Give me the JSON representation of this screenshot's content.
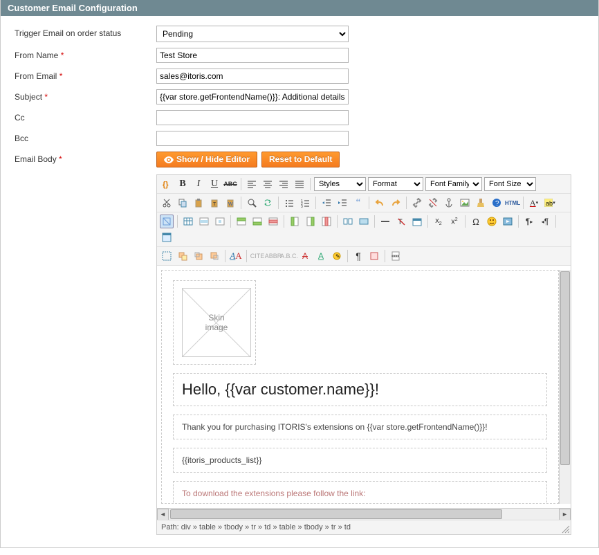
{
  "header": {
    "title": "Customer Email Configuration"
  },
  "form": {
    "trigger_label": "Trigger Email on order status",
    "trigger_value": "Pending",
    "from_name_label": "From Name",
    "from_name_value": "Test Store",
    "from_email_label": "From Email",
    "from_email_value": "sales@itoris.com",
    "subject_label": "Subject",
    "subject_value": "{{var store.getFrontendName()}}: Additional details",
    "cc_label": "Cc",
    "cc_value": "",
    "bcc_label": "Bcc",
    "bcc_value": "",
    "body_label": "Email Body"
  },
  "buttons": {
    "show_hide": "Show / Hide Editor",
    "reset": "Reset to Default"
  },
  "editor": {
    "dropdowns": {
      "styles": "Styles",
      "format": "Format",
      "fontfamily": "Font Family",
      "fontsize": "Font Size"
    },
    "content": {
      "skin_placeholder": "Skin\nimage",
      "hello": "Hello, {{var customer.name}}!",
      "thanks": "Thank you for purchasing ITORIS's extensions on {{var store.getFrontendName()}}!",
      "products": "{{itoris_products_list}}",
      "cutoff": "To download the extensions please follow the link:"
    },
    "path_prefix": "Path: ",
    "path": "div » table » tbody » tr » td » table » tbody » tr » td"
  }
}
